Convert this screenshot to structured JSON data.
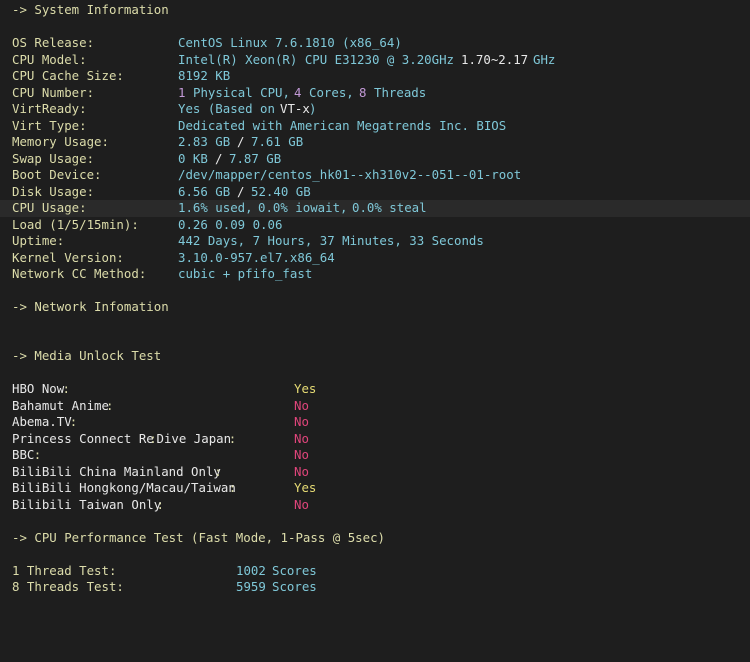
{
  "sections": {
    "system": "-> System Information",
    "network": "-> Network Infomation",
    "media": "-> Media Unlock Test",
    "cpu_perf": "-> CPU Performance Test (Fast Mode, 1-Pass @ 5sec)"
  },
  "system_info": {
    "os_release": {
      "label": "OS Release:",
      "value": "CentOS Linux 7.6.1810 (x86_64)"
    },
    "cpu_model": {
      "label": "CPU Model:",
      "value": "Intel(R) Xeon(R) CPU E31230 @ 3.20GHz",
      "freq": "1.70~2.17",
      "freq_unit": "GHz"
    },
    "cpu_cache": {
      "label": "CPU Cache Size:",
      "value": "8192 KB"
    },
    "cpu_number": {
      "label": "CPU Number:",
      "physical_count": "1",
      "physical_label": "Physical CPU,",
      "cores_count": "4",
      "cores_label": "Cores,",
      "threads_count": "8",
      "threads_label": "Threads"
    },
    "virt_ready": {
      "label": "VirtReady:",
      "value": "Yes (Based on",
      "tech": "VT-x",
      "close": ")"
    },
    "virt_type": {
      "label": "Virt Type:",
      "value": "Dedicated with American Megatrends Inc. BIOS"
    },
    "memory": {
      "label": "Memory Usage:",
      "used": "2.83 GB",
      "sep": "/",
      "total": "7.61 GB"
    },
    "swap": {
      "label": "Swap Usage:",
      "used": "0 KB",
      "sep": "/",
      "total": "7.87 GB"
    },
    "boot_device": {
      "label": "Boot Device:",
      "value": "/dev/mapper/centos_hk01--xh310v2--051--01-root"
    },
    "disk": {
      "label": "Disk Usage:",
      "used": "6.56 GB",
      "sep": "/",
      "total": "52.40 GB"
    },
    "cpu_usage": {
      "label": "CPU Usage:",
      "used_val": "1.6% used,",
      "iowait_val": "0.0% iowait,",
      "steal_val": "0.0% steal"
    },
    "load": {
      "label": "Load (1/5/15min):",
      "value": "0.26 0.09 0.06"
    },
    "uptime": {
      "label": "Uptime:",
      "value": "442 Days, 7 Hours, 37 Minutes, 33 Seconds"
    },
    "kernel": {
      "label": "Kernel Version:",
      "value": "3.10.0-957.el7.x86_64"
    },
    "network_cc": {
      "label": "Network CC Method:",
      "value": "cubic + pfifo_fast"
    }
  },
  "media_unlock": [
    {
      "name": "HBO Now",
      "result": "Yes"
    },
    {
      "name": "Bahamut Anime",
      "result": "No"
    },
    {
      "name": "Abema.TV",
      "result": "No"
    },
    {
      "name": "Princess Connect Re",
      "name2": "Dive Japan",
      "result": "No"
    },
    {
      "name": "BBC",
      "result": "No"
    },
    {
      "name": "BiliBili China Mainland Only",
      "result": "No"
    },
    {
      "name": "BiliBili Hongkong/Macau/Taiwan",
      "result": "Yes"
    },
    {
      "name": "Bilibili Taiwan Only",
      "result": "No"
    }
  ],
  "cpu_perf": [
    {
      "label": "1 Thread Test:",
      "value": "1002",
      "unit": "Scores"
    },
    {
      "label": "8 Threads Test:",
      "value": "5959",
      "unit": "Scores"
    }
  ],
  "colon": ":",
  "colors": {
    "background": "#1e1e1e",
    "header": "#dcdcaa",
    "label": "#dcdcaa",
    "value": "#7fc8d8",
    "yes": "#e6db74",
    "no": "#e0457b",
    "count": "#c39ad7"
  }
}
